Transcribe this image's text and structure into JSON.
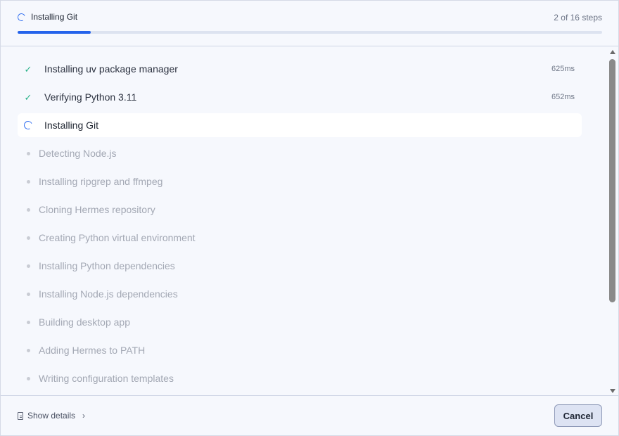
{
  "header": {
    "title": "Installing Git",
    "steps_text": "2 of 16 steps",
    "progress_fraction": 0.125
  },
  "steps": [
    {
      "label": "Installing uv package manager",
      "status": "done",
      "duration": "625ms"
    },
    {
      "label": "Verifying Python 3.11",
      "status": "done",
      "duration": "652ms"
    },
    {
      "label": "Installing Git",
      "status": "active",
      "duration": ""
    },
    {
      "label": "Detecting Node.js",
      "status": "pending",
      "duration": ""
    },
    {
      "label": "Installing ripgrep and ffmpeg",
      "status": "pending",
      "duration": ""
    },
    {
      "label": "Cloning Hermes repository",
      "status": "pending",
      "duration": ""
    },
    {
      "label": "Creating Python virtual environment",
      "status": "pending",
      "duration": ""
    },
    {
      "label": "Installing Python dependencies",
      "status": "pending",
      "duration": ""
    },
    {
      "label": "Installing Node.js dependencies",
      "status": "pending",
      "duration": ""
    },
    {
      "label": "Building desktop app",
      "status": "pending",
      "duration": ""
    },
    {
      "label": "Adding Hermes to PATH",
      "status": "pending",
      "duration": ""
    },
    {
      "label": "Writing configuration templates",
      "status": "pending",
      "duration": ""
    }
  ],
  "footer": {
    "details_label": "Show details",
    "cancel_label": "Cancel"
  },
  "colors": {
    "accent": "#2563eb",
    "success": "#2bb38a",
    "pending_text": "#a3a8b4"
  },
  "icons": {
    "active": "spinner-icon",
    "done": "checkmark-icon",
    "pending": "dot-icon",
    "details": "document-icon",
    "details_chevron": "chevron-right-icon"
  }
}
